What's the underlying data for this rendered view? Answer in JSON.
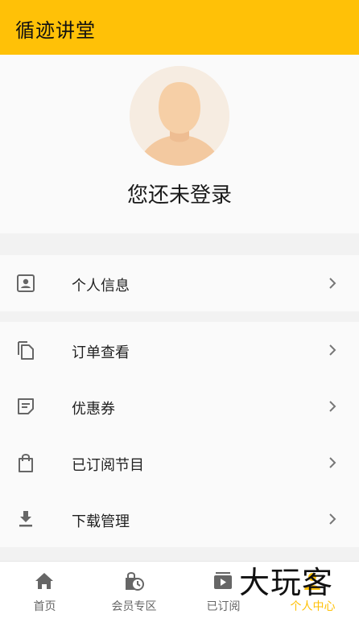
{
  "app": {
    "title": "循迹讲堂"
  },
  "profile": {
    "login_prompt": "您还未登录"
  },
  "menu_groups": [
    {
      "items": [
        {
          "label": "个人信息",
          "icon": "contact-card-icon"
        }
      ]
    },
    {
      "items": [
        {
          "label": "订单查看",
          "icon": "copy-document-icon"
        },
        {
          "label": "优惠券",
          "icon": "note-icon"
        },
        {
          "label": "已订阅节目",
          "icon": "shopping-bag-icon"
        },
        {
          "label": "下载管理",
          "icon": "download-icon"
        }
      ]
    }
  ],
  "tabs": [
    {
      "label": "首页",
      "icon": "home-icon",
      "active": false
    },
    {
      "label": "会员专区",
      "icon": "bag-clock-icon",
      "active": false
    },
    {
      "label": "已订阅",
      "icon": "tv-play-icon",
      "active": false
    },
    {
      "label": "个人中心",
      "icon": "person-icon",
      "active": true
    }
  ],
  "watermark": {
    "text": "大玩客"
  },
  "colors": {
    "accent": "#ffc107",
    "icon_gray": "#666666"
  }
}
